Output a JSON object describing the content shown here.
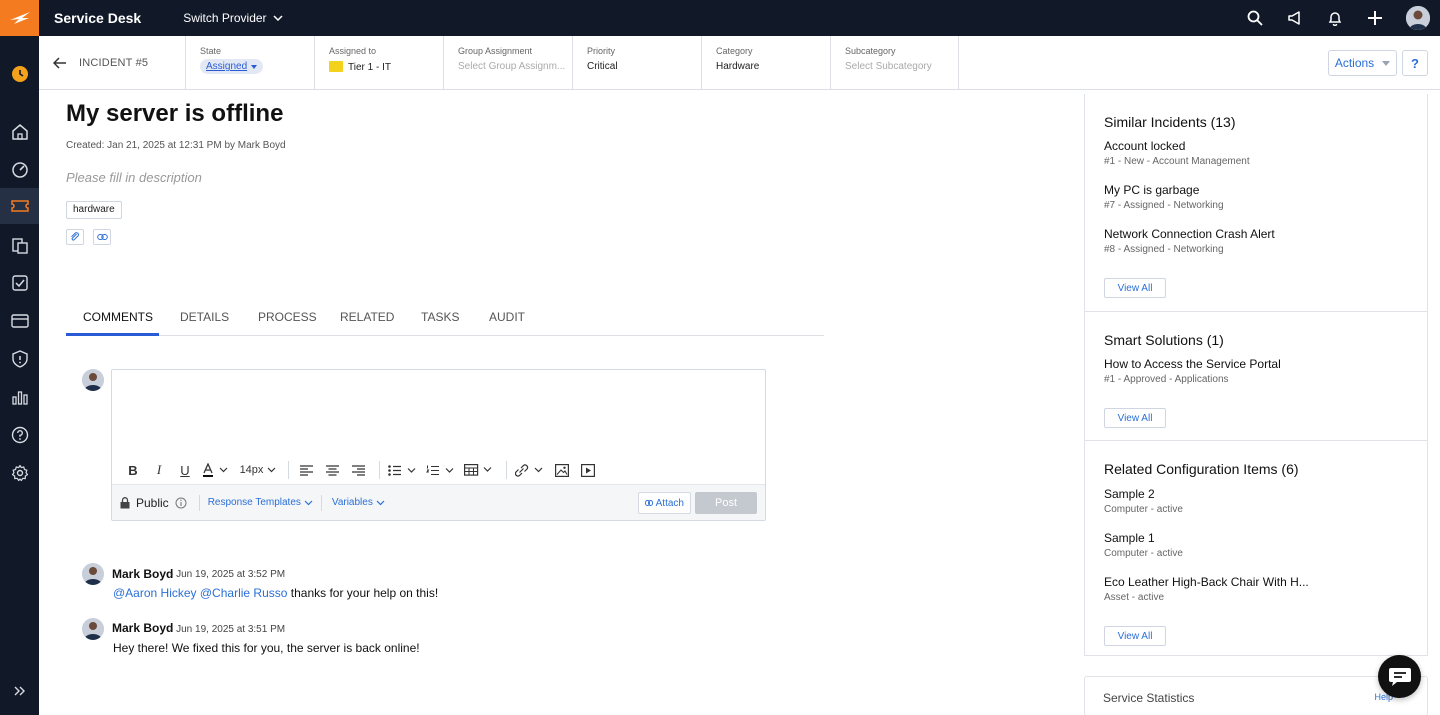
{
  "topbar": {
    "app_title": "Service Desk",
    "switch_provider_label": "Switch Provider",
    "icons": [
      "search-icon",
      "announcement-icon",
      "bell-icon",
      "plus-icon",
      "user-avatar"
    ],
    "accent": "#f47b20",
    "background": "#111827"
  },
  "rail": {
    "items": [
      "home-icon",
      "dashboard-icon",
      "ticket-icon",
      "files-icon",
      "checklist-icon",
      "billing-icon",
      "shield-icon",
      "reports-icon",
      "help-icon",
      "settings-icon"
    ],
    "active": "ticket-icon"
  },
  "header": {
    "incident_label": "INCIDENT #5",
    "fields": [
      {
        "label": "State",
        "value": "Assigned"
      },
      {
        "label": "Assigned to",
        "value": "Tier 1 - IT"
      },
      {
        "label": "Group Assignment",
        "value": "Select Group Assignm..."
      },
      {
        "label": "Priority",
        "value": "Critical"
      },
      {
        "label": "Category",
        "value": "Hardware"
      },
      {
        "label": "Subcategory",
        "value": "Select Subcategory"
      }
    ],
    "actions_label": "Actions",
    "help_label": "?"
  },
  "incident": {
    "title": "My server is offline",
    "created": "Created: Jan 21, 2025 at 12:31 PM by Mark Boyd",
    "description_placeholder": "Please fill in description",
    "tag": "hardware"
  },
  "tabs": [
    "COMMENTS",
    "DETAILS",
    "PROCESS",
    "RELATED",
    "TASKS",
    "AUDIT"
  ],
  "active_tab": "COMMENTS",
  "editor": {
    "font_size": "14px",
    "visibility": "Public",
    "response_templates": "Response Templates",
    "variables": "Variables",
    "attach": "Attach",
    "post": "Post"
  },
  "comments": [
    {
      "author": "Mark Boyd",
      "time": "- Jun 19, 2025 at 3:52 PM",
      "mentions": "@Aaron Hickey @Charlie Russo",
      "text": " thanks for your help on this!"
    },
    {
      "author": "Mark Boyd",
      "time": "- Jun 19, 2025 at 3:51 PM",
      "mentions": "",
      "text": "Hey there! We fixed this for you, the server is back online!"
    }
  ],
  "similar_incidents": {
    "title": "Similar Incidents (13)",
    "items": [
      {
        "title": "Account locked",
        "sub": "#1 - New - Account Management"
      },
      {
        "title": "My PC is garbage",
        "sub": "#7 - Assigned - Networking"
      },
      {
        "title": "Network Connection Crash Alert",
        "sub": "#8 - Assigned - Networking"
      }
    ],
    "view_all": "View All"
  },
  "smart_solutions": {
    "title": "Smart Solutions (1)",
    "items": [
      {
        "title": "How to Access the Service Portal",
        "sub": "#1 - Approved - Applications"
      }
    ],
    "view_all": "View All"
  },
  "related_ci": {
    "title": "Related Configuration Items (6)",
    "items": [
      {
        "title": "Sample 2",
        "sub": "Computer - active"
      },
      {
        "title": "Sample 1",
        "sub": "Computer - active"
      },
      {
        "title": "Eco Leather High-Back Chair With H...",
        "sub": "Asset - active"
      }
    ],
    "view_all": "View All"
  },
  "service_statistics": {
    "title": "Service Statistics",
    "help": "Help"
  }
}
